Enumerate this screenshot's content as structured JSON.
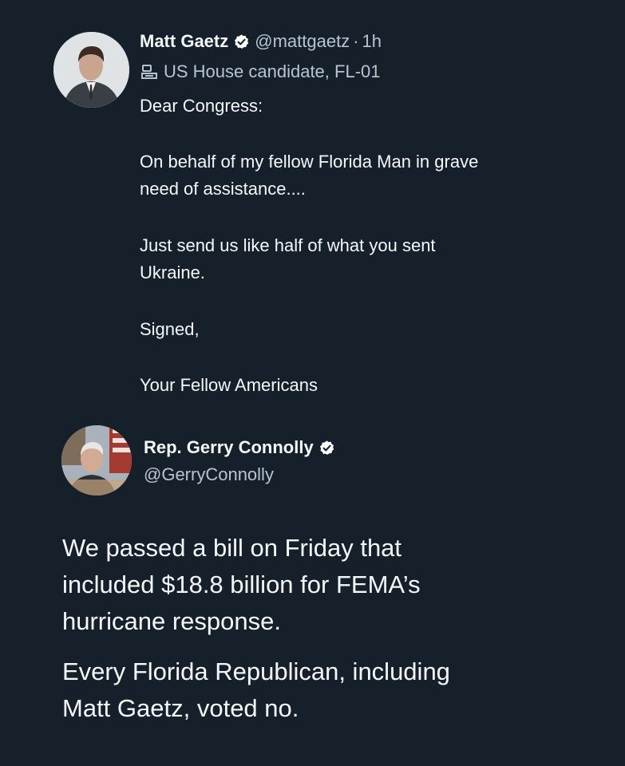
{
  "top_tweet": {
    "display_name": "Matt Gaetz",
    "handle": "@mattgaetz",
    "separator": "·",
    "time": "1h",
    "label": "US House candidate, FL-01",
    "lines": [
      "Dear Congress:",
      "On behalf of my fellow Florida Man in grave",
      "need of assistance....",
      "Just send us like half of what you sent",
      "Ukraine.",
      "Signed,",
      "Your Fellow Americans"
    ]
  },
  "reply_tweet": {
    "display_name": "Rep. Gerry Connolly",
    "handle": "@GerryConnolly",
    "lines": [
      "We passed a bill on Friday that",
      "included $18.8 billion for FEMA’s",
      "hurricane response.",
      "Every Florida Republican, including",
      "Matt Gaetz, voted no."
    ]
  },
  "colors": {
    "background": "#15202b",
    "text": "#f5f8fa",
    "secondary_text": "#b8c4cf"
  },
  "icons": {
    "verified": "verified-badge-icon",
    "label": "government-building-icon"
  }
}
